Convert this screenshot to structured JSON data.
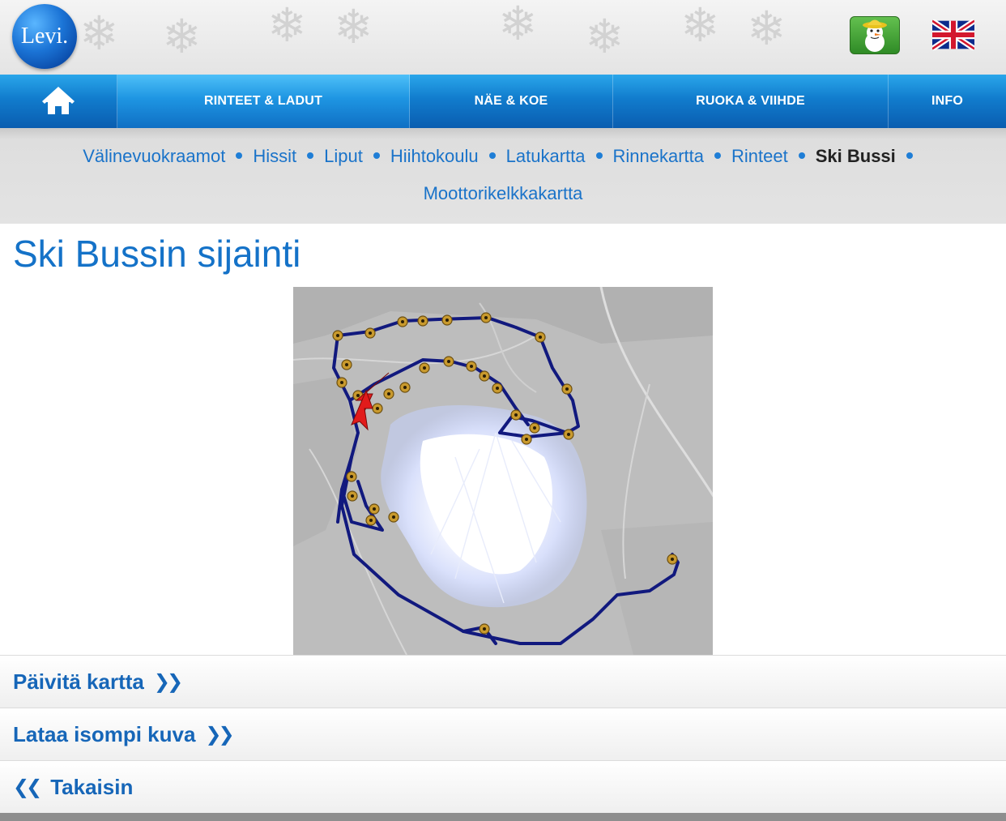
{
  "header": {
    "logo_text": "Levi.",
    "kids_icon": "snowman-icon",
    "language_icon": "uk-flag-icon"
  },
  "nav": {
    "home_icon": "home-icon",
    "items": [
      {
        "label": "RINTEET & LADUT",
        "active": true
      },
      {
        "label": "NÄE & KOE",
        "active": false
      },
      {
        "label": "RUOKA & VIIHDE",
        "active": false
      },
      {
        "label": "INFO",
        "active": false
      }
    ]
  },
  "subnav": {
    "row1": [
      "Välinevuokraamot",
      "Hissit",
      "Liput",
      "Hiihtokoulu",
      "Latukartta",
      "Rinnekartta",
      "Rinteet",
      "Ski Bussi"
    ],
    "row2": [
      "Moottorikelkkakartta"
    ],
    "current": "Ski Bussi"
  },
  "main": {
    "title": "Ski Bussin sijainti",
    "map_icon": "bus-route-map"
  },
  "actions": {
    "refresh_label": "Päivitä kartta",
    "larger_label": "Lataa isompi kuva",
    "back_label": "Takaisin"
  },
  "colors": {
    "nav_blue": "#117ccd",
    "link_blue": "#1a73c9",
    "route_blue": "#11197e",
    "marker_gold": "#c99a2e",
    "arrow_red": "#e21b1b"
  }
}
